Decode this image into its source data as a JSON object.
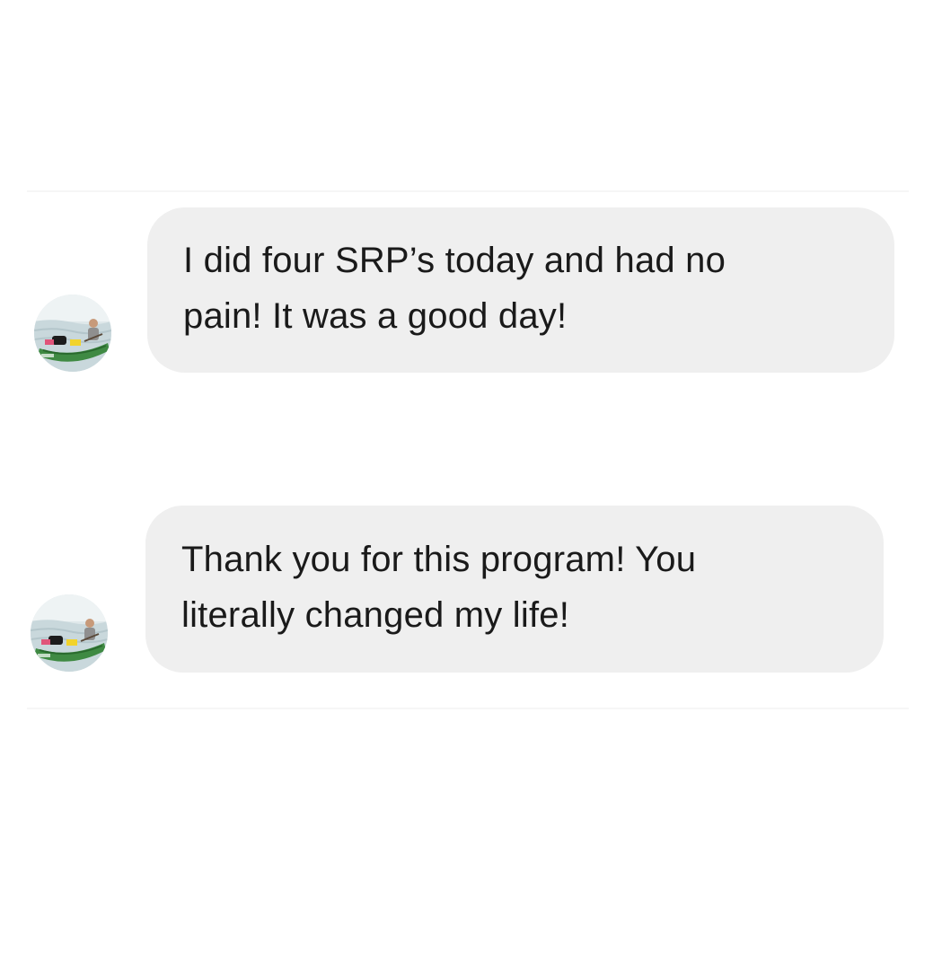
{
  "conversation": {
    "messages": [
      {
        "lines": [
          "I did four SRP’s today and had no",
          "pain! It was a good day!"
        ],
        "avatar_icon": "kayak-photo-avatar"
      },
      {
        "lines": [
          "Thank you for this program! You",
          "literally changed my life!"
        ],
        "avatar_icon": "kayak-photo-avatar"
      }
    ]
  },
  "colors": {
    "bubble_background": "#efefef",
    "text": "#1a1a1a",
    "page_background": "#ffffff"
  }
}
